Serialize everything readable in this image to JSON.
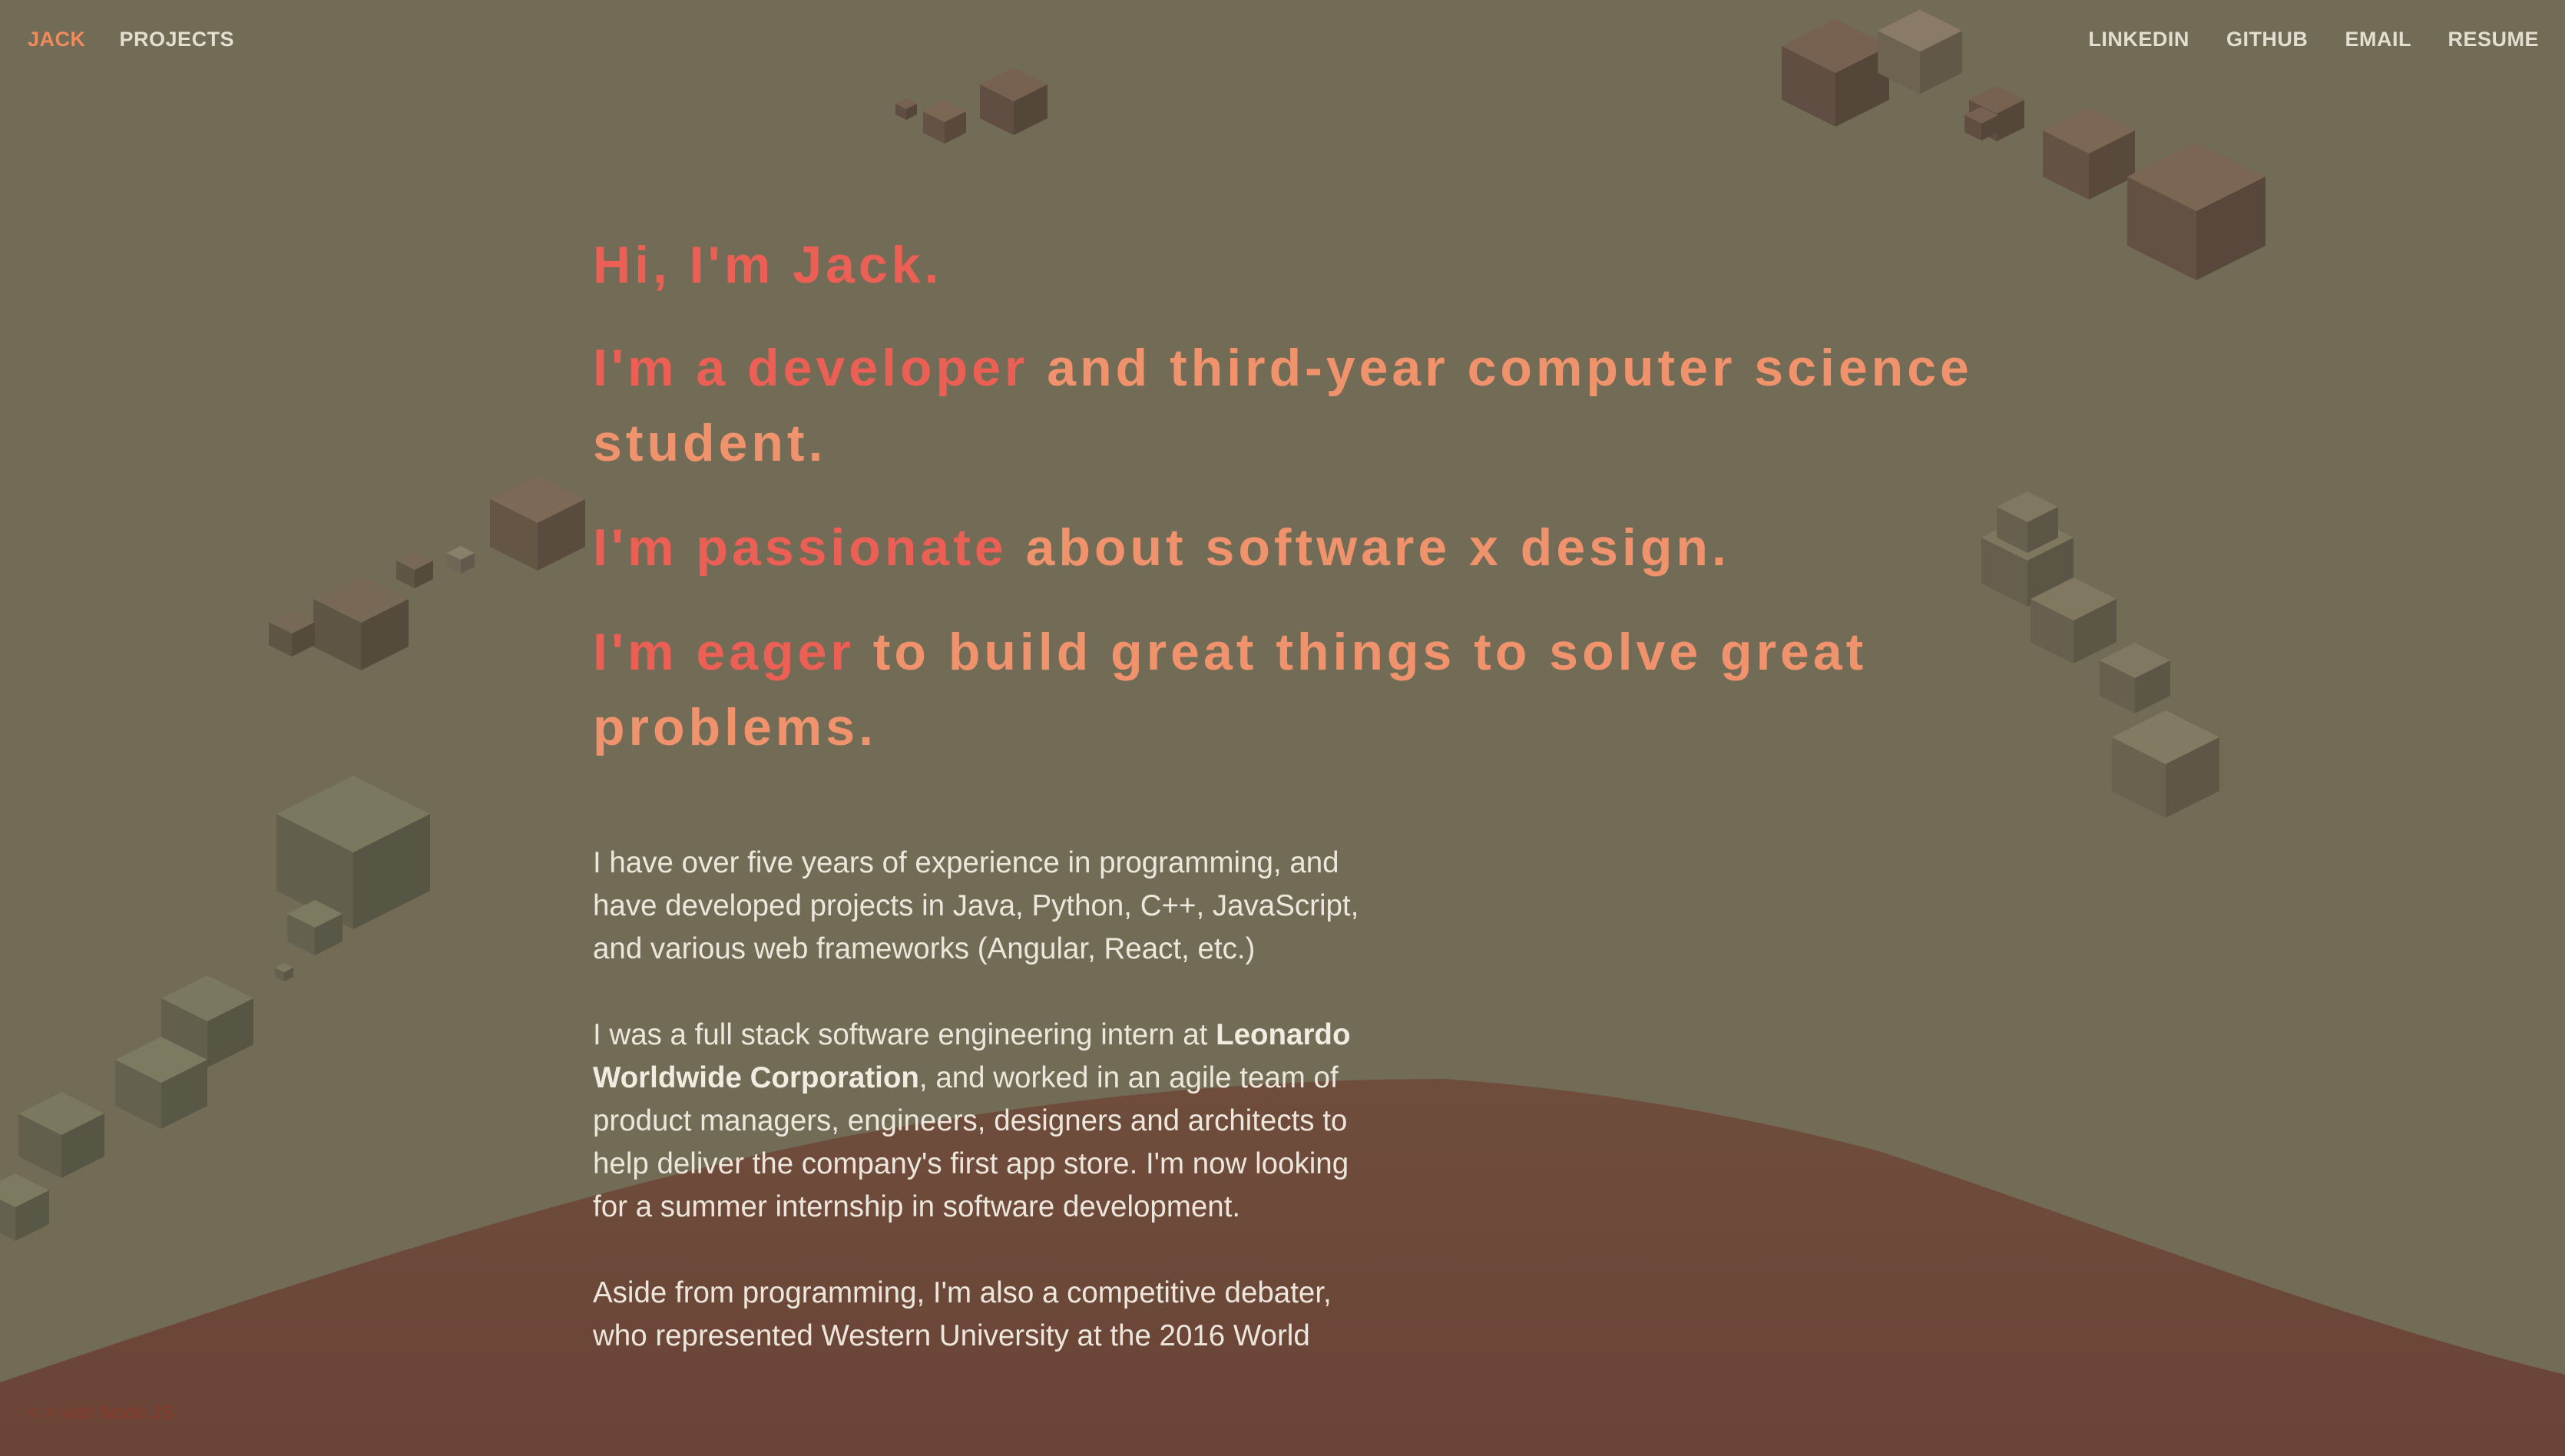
{
  "colors": {
    "background": "#726b56",
    "hill": "#6b4a3b",
    "accent_red": "#ec5f54",
    "accent_orange": "#f0936c",
    "nav_text": "#e4ddd2",
    "body_text": "#ece6dc"
  },
  "nav": {
    "brand": "JACK",
    "projects": "PROJECTS",
    "linkedin": "LINKEDIN",
    "github": "GITHUB",
    "email": "EMAIL",
    "resume": "RESUME"
  },
  "hero": {
    "greeting": "Hi, I'm Jack.",
    "line1": {
      "highlight": "I'm a developer",
      "rest": "and third-year computer science student."
    },
    "line2": {
      "highlight": "I'm passionate",
      "rest": "about software x design."
    },
    "line3": {
      "highlight": "I'm eager",
      "rest": "to build great things to solve great problems."
    }
  },
  "bio": {
    "p1": "I have over five years of experience in programming, and have developed projects in Java, Python, C++, JavaScript, and various web frameworks (Angular, React, etc.)",
    "p2_prefix": "I was a full stack software engineering intern at ",
    "p2_company": "Leonardo Worldwide Corporation",
    "p2_suffix": ", and worked in an agile team of product managers, engineers, designers and architects to help deliver the company's first app store. I'm now looking for a summer internship in software development.",
    "p3": "Aside from programming, I'm also a competitive debater, who represented Western University at the 2016 World"
  },
  "footer": {
    "built_with": "< > with Node.JS"
  }
}
